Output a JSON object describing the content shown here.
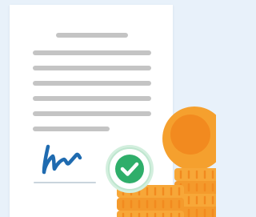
{
  "illustration": {
    "subject": "document-signature-coins-icon",
    "background_color": "#e8f1fa",
    "document": {
      "paper_color": "#ffffff",
      "line_color": "#c4c4c4",
      "title_line_count": 1,
      "body_line_count": 6
    },
    "signature": {
      "icon": "handwritten-signature-icon",
      "ink_color": "#1f6bb0"
    },
    "badge": {
      "icon": "checkmark-badge-icon",
      "ring_color": "#bfe6cf",
      "fill_color": "#2fae6a"
    },
    "coins": {
      "icon": "coin-stack-icon",
      "face_color": "#f7a738",
      "edge_color": "#f28a1f",
      "standing_coin_color": "#f5a02e"
    }
  }
}
